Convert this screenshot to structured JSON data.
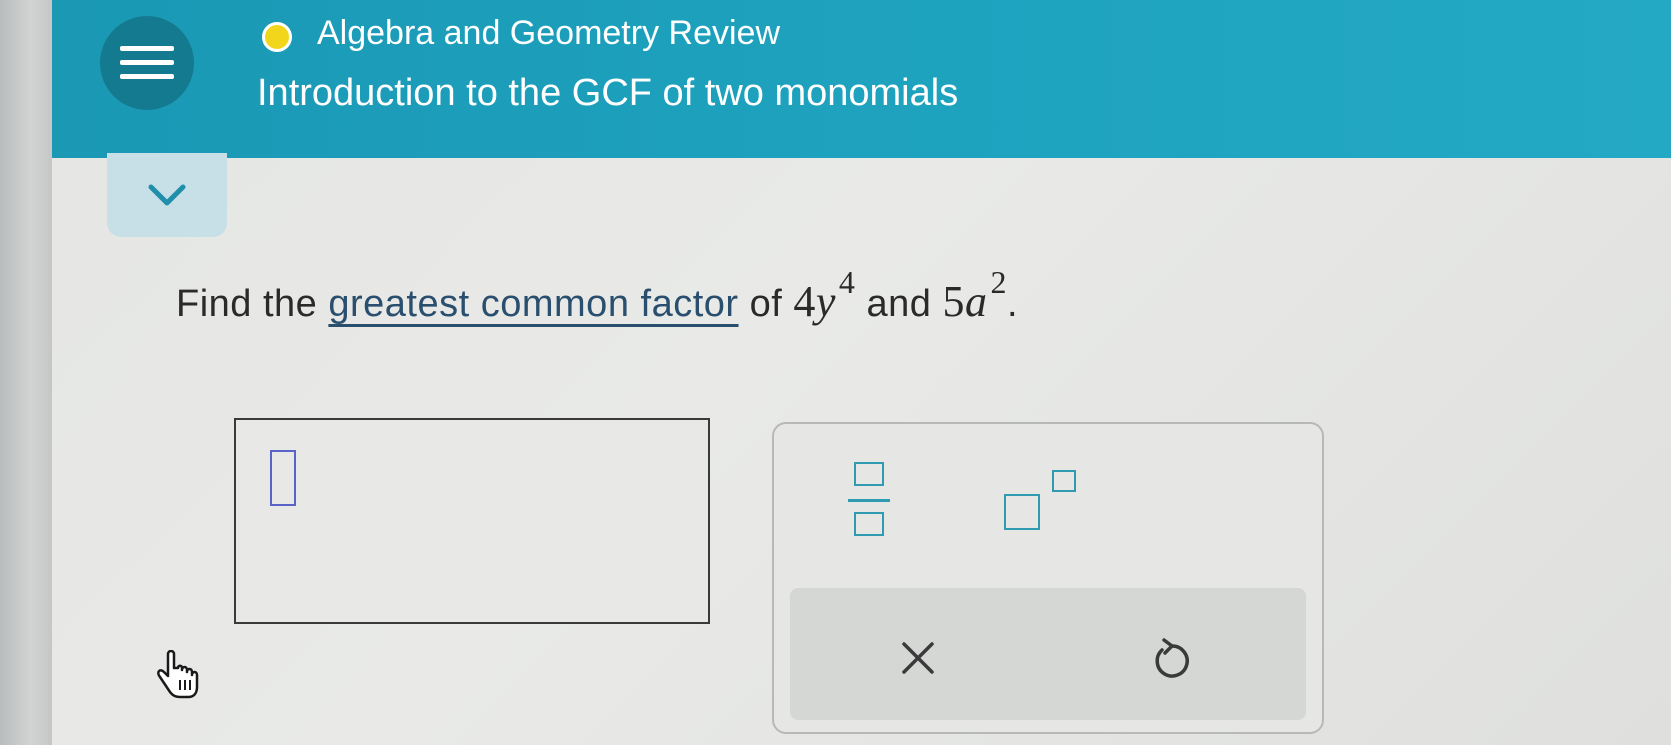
{
  "header": {
    "course_title": "Algebra and Geometry Review",
    "topic_title": "Introduction to the GCF of two monomials",
    "menu_icon": "hamburger-menu-icon",
    "status_color": "#f2d61c",
    "bg_color": "#1ea3bf"
  },
  "expand_toggle": {
    "icon": "chevron-down-icon"
  },
  "question": {
    "prefix": "Find the",
    "link_text": "greatest common factor",
    "of": "of",
    "term1_coeff": "4",
    "term1_var": "y",
    "term1_exp": "4",
    "and": "and",
    "term2_coeff": "5",
    "term2_var": "a",
    "term2_exp": "2",
    "period": "."
  },
  "answer": {
    "value": ""
  },
  "toolbar": {
    "fraction_icon": "fraction-icon",
    "exponent_icon": "exponent-icon",
    "clear_icon": "x-icon",
    "undo_icon": "undo-icon"
  },
  "cursor": {
    "icon": "hand-pointer-icon"
  }
}
